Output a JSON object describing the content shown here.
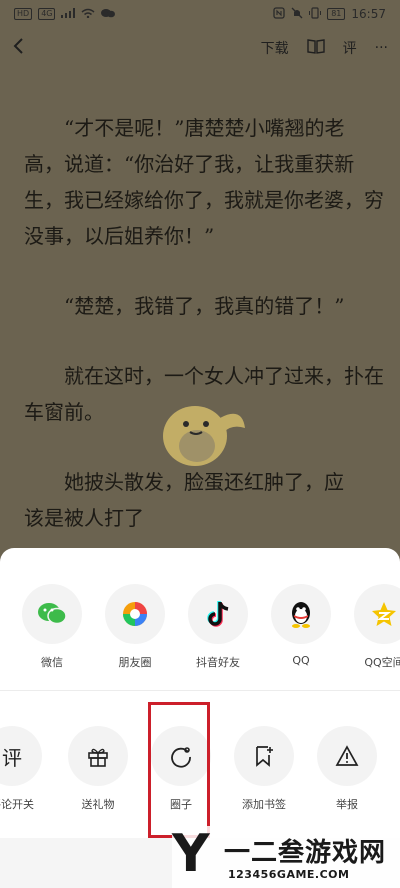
{
  "status_bar": {
    "left_badges": [
      "HD",
      "4G"
    ],
    "battery": "81",
    "time": "16:57"
  },
  "toolbar": {
    "back_icon": "back-icon",
    "download_label": "下载",
    "book_icon": "book-icon",
    "comment_label": "评",
    "more_label": "···"
  },
  "reader": {
    "paragraphs": [
      "“才不是呢！”唐楚楚小嘴翘的老高，说道：“你治好了我，让我重获新生，我已经嫁给你了，我就是你老婆，穷没事，以后姐养你！”",
      "“楚楚，我错了，我真的错了！”",
      "就在这时，一个女人冲了过来，扑在车窗前。",
      "她披头散发，脸蛋还红肿了，应"
    ],
    "partial_bottom": "该是被人打了"
  },
  "share_items": [
    {
      "label": "微信",
      "icon": "wechat-icon"
    },
    {
      "label": "朋友圈",
      "icon": "moments-icon"
    },
    {
      "label": "抖音好友",
      "icon": "douyin-icon"
    },
    {
      "label": "QQ",
      "icon": "qq-icon"
    },
    {
      "label": "QQ空间",
      "icon": "qzone-icon"
    }
  ],
  "action_items": [
    {
      "label": "评论开关",
      "icon": "comment-toggle-icon"
    },
    {
      "label": "送礼物",
      "icon": "gift-icon"
    },
    {
      "label": "圈子",
      "icon": "circle-icon"
    },
    {
      "label": "添加书签",
      "icon": "bookmark-icon"
    },
    {
      "label": "举报",
      "icon": "report-icon"
    }
  ],
  "watermark": {
    "letter": "Y",
    "name": "一二叁游戏网",
    "url": "123456GAME.COM"
  },
  "colors": {
    "overlay_bg": "#6b6350",
    "highlight_red": "#cc1f2a",
    "wechat_green": "#3dbb4a",
    "qq_yellow": "#f5c400"
  }
}
